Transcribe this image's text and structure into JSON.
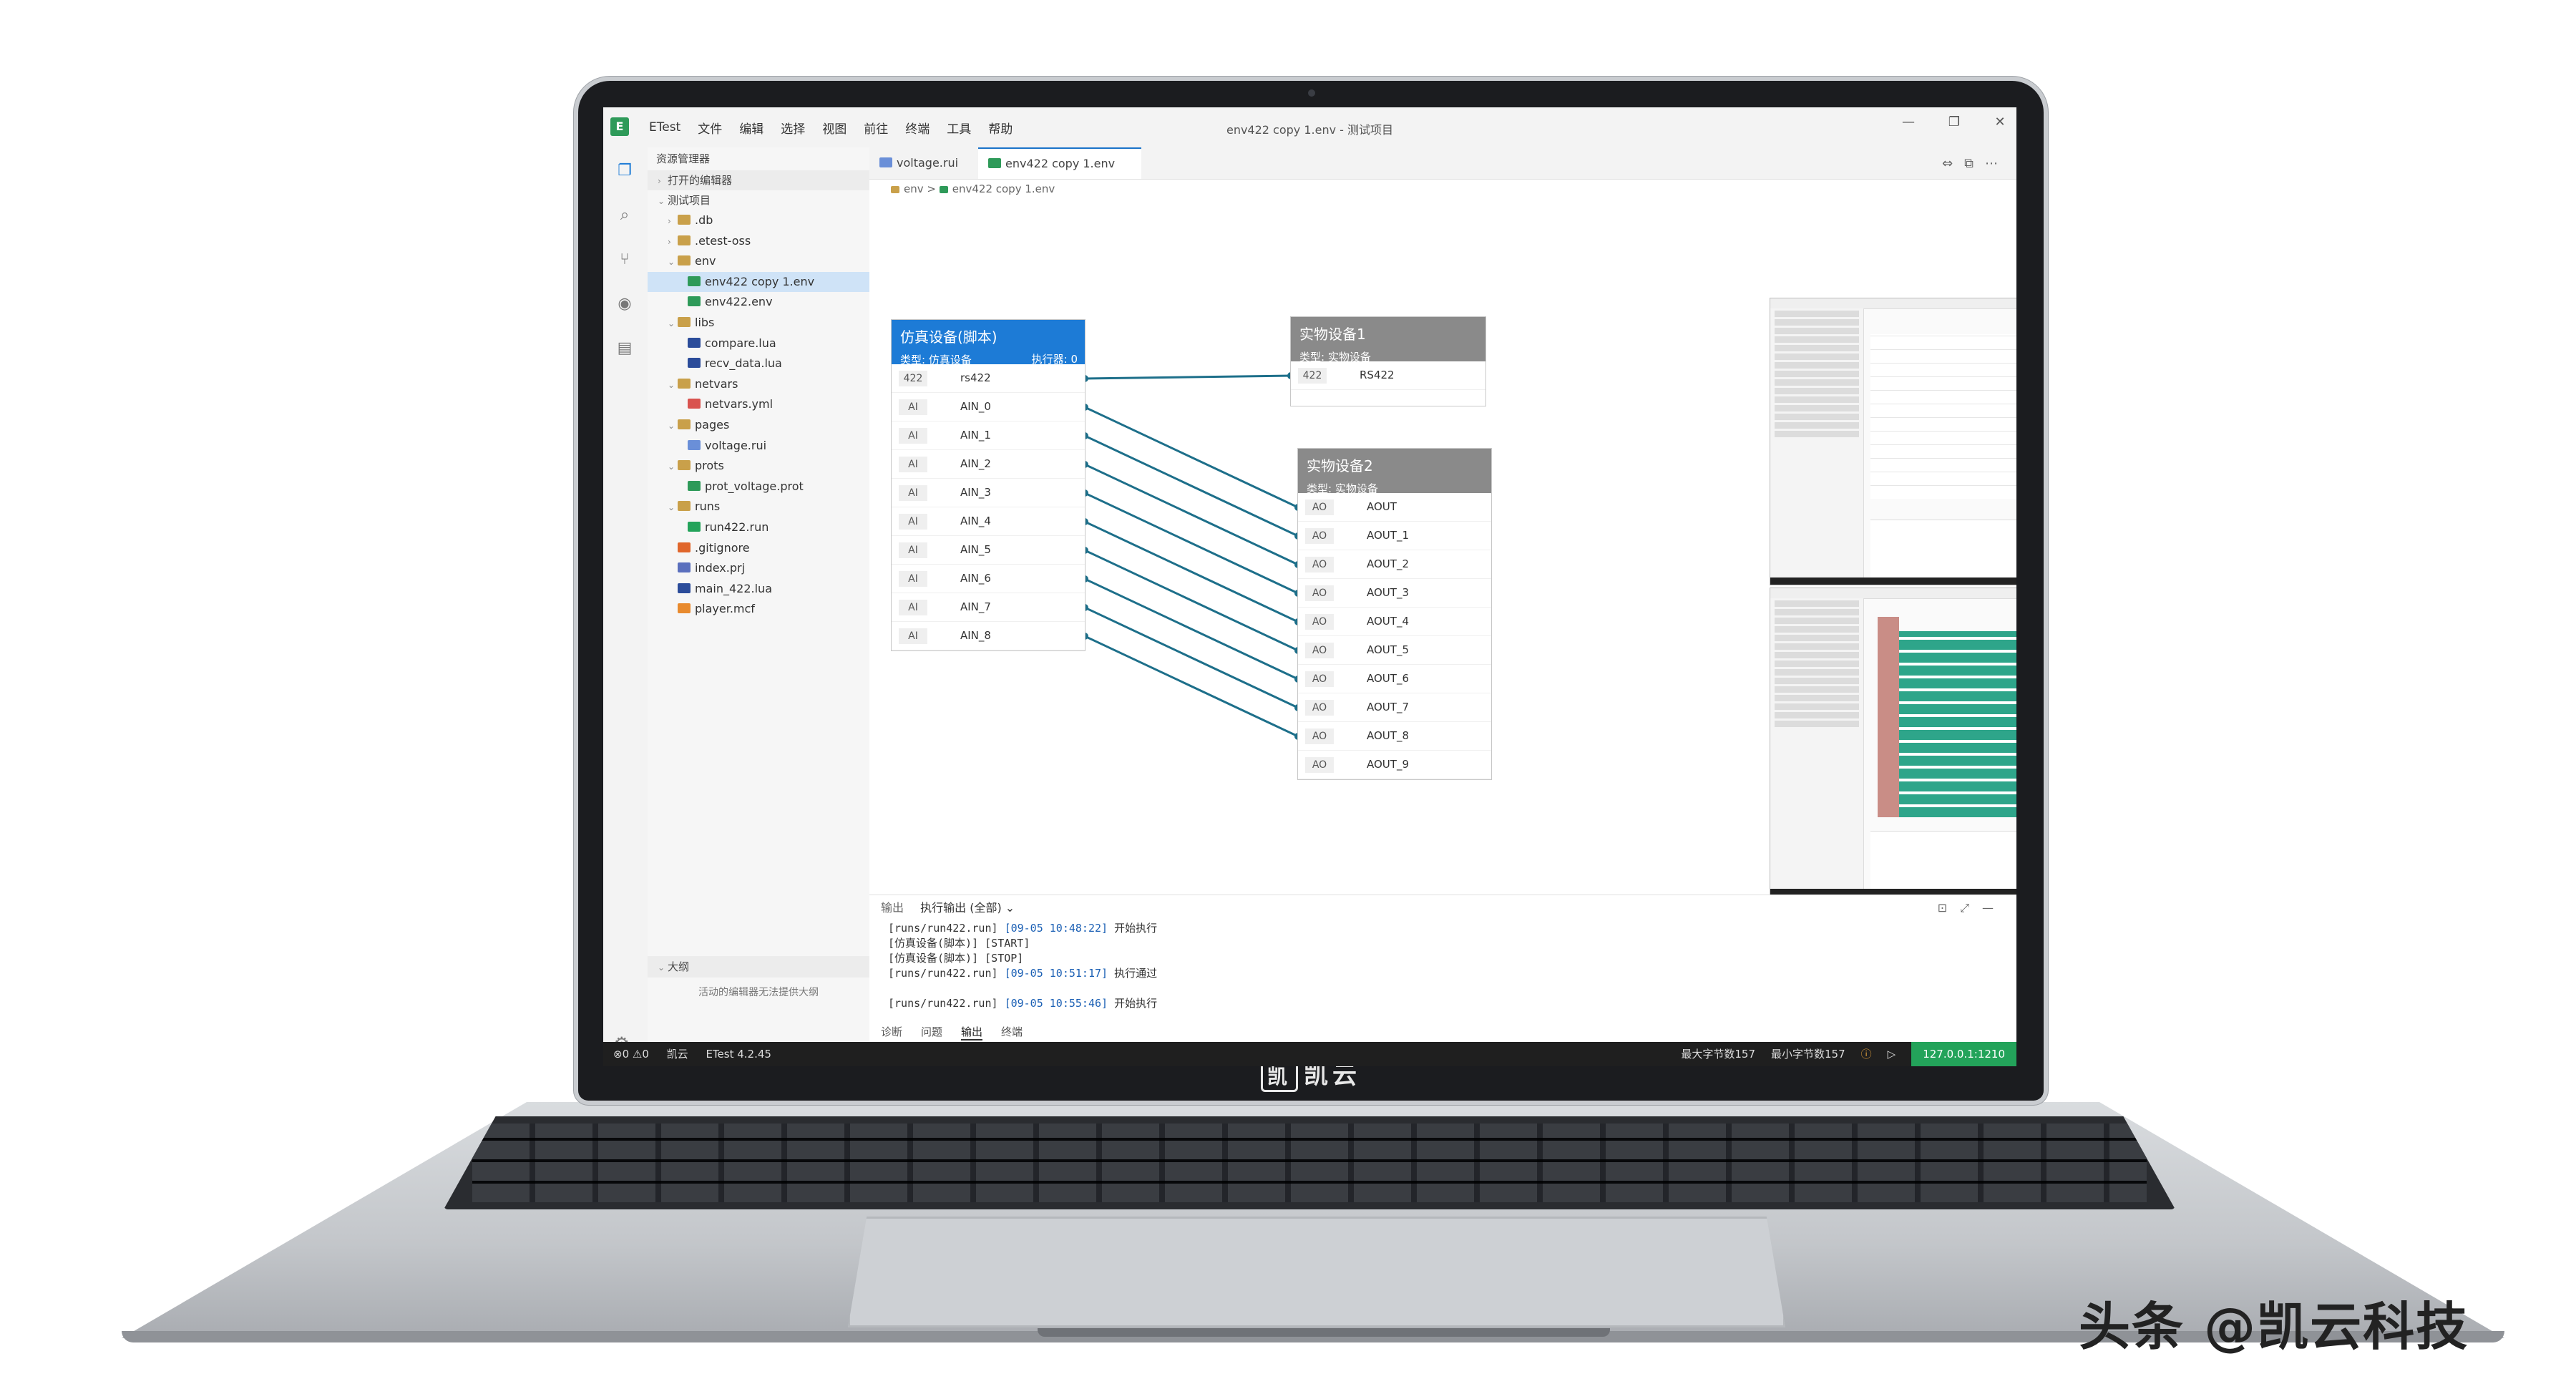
{
  "window": {
    "app_name": "ETest",
    "title": "env422 copy 1.env - 测试项目",
    "controls": [
      "—",
      "❐",
      "✕"
    ]
  },
  "menu": [
    "文件",
    "编辑",
    "选择",
    "视图",
    "前往",
    "终端",
    "工具",
    "帮助"
  ],
  "sidebar": {
    "title": "资源管理器",
    "open_editors": "打开的编辑器",
    "project": "测试项目",
    "tree": [
      {
        "label": ".db",
        "depth": 1,
        "kind": "folder",
        "state": "closed"
      },
      {
        "label": ".etest-oss",
        "depth": 1,
        "kind": "folder",
        "state": "closed"
      },
      {
        "label": "env",
        "depth": 1,
        "kind": "folder",
        "state": "open"
      },
      {
        "label": "env422 copy 1.env",
        "depth": 2,
        "kind": "env",
        "selected": true
      },
      {
        "label": "env422.env",
        "depth": 2,
        "kind": "env"
      },
      {
        "label": "libs",
        "depth": 1,
        "kind": "folder",
        "state": "open"
      },
      {
        "label": "compare.lua",
        "depth": 2,
        "kind": "lua"
      },
      {
        "label": "recv_data.lua",
        "depth": 2,
        "kind": "lua"
      },
      {
        "label": "netvars",
        "depth": 1,
        "kind": "folder",
        "state": "open"
      },
      {
        "label": "netvars.yml",
        "depth": 2,
        "kind": "yml"
      },
      {
        "label": "pages",
        "depth": 1,
        "kind": "folder",
        "state": "open"
      },
      {
        "label": "voltage.rui",
        "depth": 2,
        "kind": "rui"
      },
      {
        "label": "prots",
        "depth": 1,
        "kind": "folder",
        "state": "open"
      },
      {
        "label": "prot_voltage.prot",
        "depth": 2,
        "kind": "prot"
      },
      {
        "label": "runs",
        "depth": 1,
        "kind": "folder",
        "state": "open"
      },
      {
        "label": "run422.run",
        "depth": 2,
        "kind": "run"
      },
      {
        "label": ".gitignore",
        "depth": 1,
        "kind": "git"
      },
      {
        "label": "index.prj",
        "depth": 1,
        "kind": "prj"
      },
      {
        "label": "main_422.lua",
        "depth": 1,
        "kind": "lua"
      },
      {
        "label": "player.mcf",
        "depth": 1,
        "kind": "mcf"
      }
    ],
    "outline_title": "大纲",
    "outline_message": "活动的编辑器无法提供大纲"
  },
  "tabs": [
    {
      "label": "voltage.rui",
      "active": false
    },
    {
      "label": "env422 copy 1.env",
      "active": true
    }
  ],
  "breadcrumb": [
    "env",
    "env422 copy 1.env"
  ],
  "nodes": {
    "sim": {
      "title": "仿真设备(脚本)",
      "type_label": "类型: 仿真设备",
      "exec_label": "执行器: 0",
      "ports": [
        {
          "tag": "422",
          "name": "rs422"
        },
        {
          "tag": "AI",
          "name": "AIN_0"
        },
        {
          "tag": "AI",
          "name": "AIN_1"
        },
        {
          "tag": "AI",
          "name": "AIN_2"
        },
        {
          "tag": "AI",
          "name": "AIN_3"
        },
        {
          "tag": "AI",
          "name": "AIN_4"
        },
        {
          "tag": "AI",
          "name": "AIN_5"
        },
        {
          "tag": "AI",
          "name": "AIN_6"
        },
        {
          "tag": "AI",
          "name": "AIN_7"
        },
        {
          "tag": "AI",
          "name": "AIN_8"
        }
      ]
    },
    "real1": {
      "title": "实物设备1",
      "type_label": "类型: 实物设备",
      "ports": [
        {
          "tag": "422",
          "name": "RS422"
        }
      ]
    },
    "real2": {
      "title": "实物设备2",
      "type_label": "类型: 实物设备",
      "ports": [
        {
          "tag": "AO",
          "name": "AOUT"
        },
        {
          "tag": "AO",
          "name": "AOUT_1"
        },
        {
          "tag": "AO",
          "name": "AOUT_2"
        },
        {
          "tag": "AO",
          "name": "AOUT_3"
        },
        {
          "tag": "AO",
          "name": "AOUT_4"
        },
        {
          "tag": "AO",
          "name": "AOUT_5"
        },
        {
          "tag": "AO",
          "name": "AOUT_6"
        },
        {
          "tag": "AO",
          "name": "AOUT_7"
        },
        {
          "tag": "AO",
          "name": "AOUT_8"
        },
        {
          "tag": "AO",
          "name": "AOUT_9"
        }
      ]
    }
  },
  "panel": {
    "title": "输出",
    "select": "执行输出 (全部)",
    "log": [
      {
        "pre": "[runs/run422.run] ",
        "ts": "[09-05 10:48:22]",
        "post": " 开始执行"
      },
      {
        "pre": "[仿真设备(脚本)] [START]",
        "ts": "",
        "post": ""
      },
      {
        "pre": "[仿真设备(脚本)] [STOP]",
        "ts": "",
        "post": ""
      },
      {
        "pre": "[runs/run422.run] ",
        "ts": "[09-05 10:51:17]",
        "post": " 执行通过"
      },
      {
        "pre": "",
        "ts": "",
        "post": ""
      },
      {
        "pre": "[runs/run422.run] ",
        "ts": "[09-05 10:55:46]",
        "post": " 开始执行"
      }
    ],
    "tabs": [
      "诊断",
      "问题",
      "输出",
      "终端"
    ],
    "active_tab": "输出"
  },
  "status": {
    "problems": "⊗0 ⚠0",
    "company": "凯云",
    "version": "ETest  4.2.45",
    "max_bytes": "最大字节数157",
    "min_bytes": "最小字节数157",
    "ip": "127.0.0.1:1210"
  },
  "device": {
    "brand": "凯云",
    "watermark": "头条 @凯云科技"
  },
  "colors": {
    "accent": "#1d7bd6",
    "wire": "#1d6f8a",
    "status_ok": "#23a35a"
  }
}
